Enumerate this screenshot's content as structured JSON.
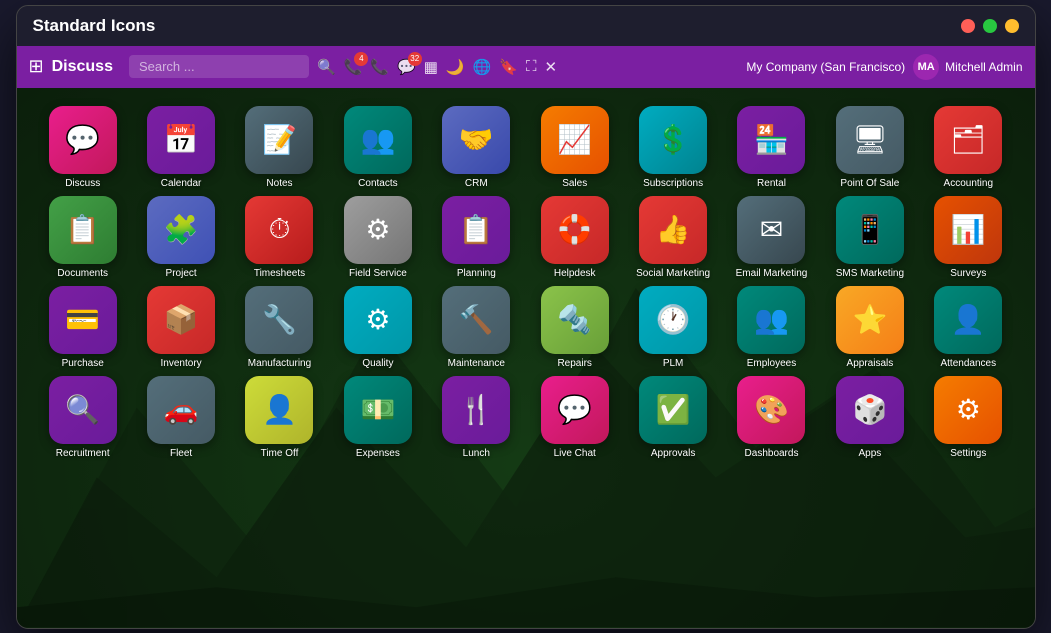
{
  "window": {
    "title": "Standard Icons",
    "controls": {
      "red": "close",
      "yellow": "minimize",
      "green": "maximize"
    }
  },
  "topbar": {
    "title": "Discuss",
    "search_placeholder": "Search ...",
    "company": "My Company (San Francisco)",
    "user": "Mitchell Admin",
    "badges": {
      "phone": "4",
      "chat": "32"
    }
  },
  "apps": [
    {
      "id": "discuss",
      "label": "Discuss",
      "icon": "💬",
      "color_class": "ic-discuss"
    },
    {
      "id": "calendar",
      "label": "Calendar",
      "icon": "📅",
      "color_class": "ic-calendar"
    },
    {
      "id": "notes",
      "label": "Notes",
      "icon": "📝",
      "color_class": "ic-notes"
    },
    {
      "id": "contacts",
      "label": "Contacts",
      "icon": "👥",
      "color_class": "ic-contacts"
    },
    {
      "id": "crm",
      "label": "CRM",
      "icon": "🤝",
      "color_class": "ic-crm"
    },
    {
      "id": "sales",
      "label": "Sales",
      "icon": "📈",
      "color_class": "ic-sales"
    },
    {
      "id": "subscriptions",
      "label": "Subscriptions",
      "icon": "💲",
      "color_class": "ic-subscriptions"
    },
    {
      "id": "rental",
      "label": "Rental",
      "icon": "🏪",
      "color_class": "ic-rental"
    },
    {
      "id": "pos",
      "label": "Point Of Sale",
      "icon": "🖥",
      "color_class": "ic-pos"
    },
    {
      "id": "accounting",
      "label": "Accounting",
      "icon": "🗂",
      "color_class": "ic-accounting"
    },
    {
      "id": "documents",
      "label": "Documents",
      "icon": "📋",
      "color_class": "ic-documents"
    },
    {
      "id": "project",
      "label": "Project",
      "icon": "🧩",
      "color_class": "ic-project"
    },
    {
      "id": "timesheets",
      "label": "Timesheets",
      "icon": "⏱",
      "color_class": "ic-timesheets"
    },
    {
      "id": "fieldservice",
      "label": "Field Service",
      "icon": "⚙",
      "color_class": "ic-fieldservice"
    },
    {
      "id": "planning",
      "label": "Planning",
      "icon": "📋",
      "color_class": "ic-planning"
    },
    {
      "id": "helpdesk",
      "label": "Helpdesk",
      "icon": "🛟",
      "color_class": "ic-helpdesk"
    },
    {
      "id": "socialmarketing",
      "label": "Social Marketing",
      "icon": "👍",
      "color_class": "ic-socialmarketing"
    },
    {
      "id": "emailmarketing",
      "label": "Email Marketing",
      "icon": "✉",
      "color_class": "ic-emailmarketing"
    },
    {
      "id": "smsmarketing",
      "label": "SMS Marketing",
      "icon": "📱",
      "color_class": "ic-smsmarketing"
    },
    {
      "id": "surveys",
      "label": "Surveys",
      "icon": "📊",
      "color_class": "ic-surveys"
    },
    {
      "id": "purchase",
      "label": "Purchase",
      "icon": "💳",
      "color_class": "ic-purchase"
    },
    {
      "id": "inventory",
      "label": "Inventory",
      "icon": "📦",
      "color_class": "ic-inventory"
    },
    {
      "id": "manufacturing",
      "label": "Manufacturing",
      "icon": "🔧",
      "color_class": "ic-manufacturing"
    },
    {
      "id": "quality",
      "label": "Quality",
      "icon": "⚙",
      "color_class": "ic-quality"
    },
    {
      "id": "maintenance",
      "label": "Maintenance",
      "icon": "🔨",
      "color_class": "ic-maintenance"
    },
    {
      "id": "repairs",
      "label": "Repairs",
      "icon": "🔩",
      "color_class": "ic-repairs"
    },
    {
      "id": "plm",
      "label": "PLM",
      "icon": "🕐",
      "color_class": "ic-plm"
    },
    {
      "id": "employees",
      "label": "Employees",
      "icon": "👥",
      "color_class": "ic-employees"
    },
    {
      "id": "appraisals",
      "label": "Appraisals",
      "icon": "⭐",
      "color_class": "ic-appraisals"
    },
    {
      "id": "attendances",
      "label": "Attendances",
      "icon": "👤",
      "color_class": "ic-attendances"
    },
    {
      "id": "recruitment",
      "label": "Recruitment",
      "icon": "🔍",
      "color_class": "ic-recruitment"
    },
    {
      "id": "fleet",
      "label": "Fleet",
      "icon": "🚗",
      "color_class": "ic-fleet"
    },
    {
      "id": "timeoff",
      "label": "Time Off",
      "icon": "👤",
      "color_class": "ic-timeoff"
    },
    {
      "id": "expenses",
      "label": "Expenses",
      "icon": "💵",
      "color_class": "ic-expenses"
    },
    {
      "id": "lunch",
      "label": "Lunch",
      "icon": "🍴",
      "color_class": "ic-lunch"
    },
    {
      "id": "livechat",
      "label": "Live Chat",
      "icon": "💬",
      "color_class": "ic-livechat"
    },
    {
      "id": "approvals",
      "label": "Approvals",
      "icon": "✅",
      "color_class": "ic-approvals"
    },
    {
      "id": "dashboards",
      "label": "Dashboards",
      "icon": "🎨",
      "color_class": "ic-dashboards"
    },
    {
      "id": "apps",
      "label": "Apps",
      "icon": "🎲",
      "color_class": "ic-apps"
    },
    {
      "id": "settings",
      "label": "Settings",
      "icon": "⚙",
      "color_class": "ic-settings"
    }
  ]
}
